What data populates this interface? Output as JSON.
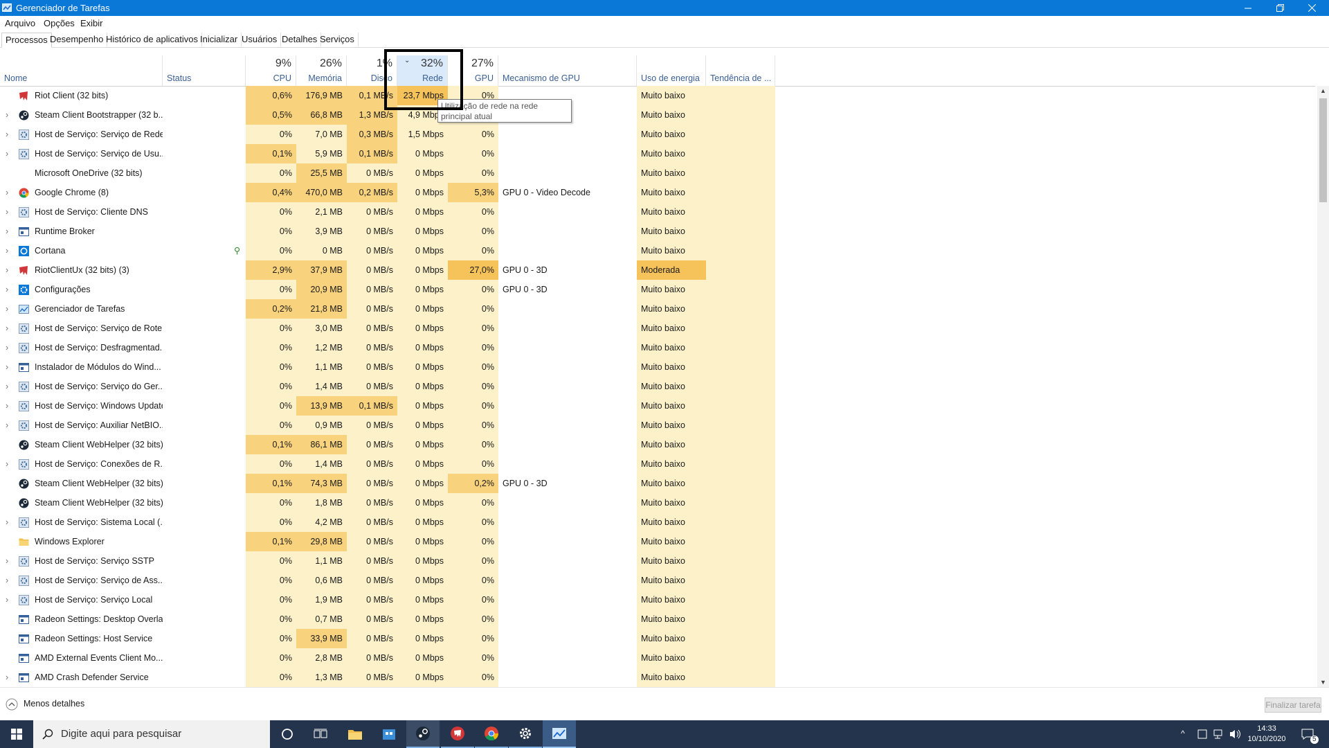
{
  "window": {
    "title": "Gerenciador de Tarefas"
  },
  "menu": [
    "Arquivo",
    "Opções",
    "Exibir"
  ],
  "tabs": [
    "Processos",
    "Desempenho",
    "Histórico de aplicativos",
    "Inicializar",
    "Usuários",
    "Detalhes",
    "Serviços"
  ],
  "columns": {
    "name": "Nome",
    "status": "Status",
    "cpu": {
      "label": "CPU",
      "pct": "9%"
    },
    "memory": {
      "label": "Memória",
      "pct": "26%"
    },
    "disk": {
      "label": "Disco",
      "pct": "1%"
    },
    "network": {
      "label": "Rede",
      "pct": "32%"
    },
    "gpu": {
      "label": "GPU",
      "pct": "27%"
    },
    "gpu_engine": "Mecanismo de GPU",
    "power": "Uso de energia",
    "power_trend": "Tendência de ..."
  },
  "tooltip": "Utilização de rede na rede principal atual",
  "rows": [
    {
      "name": "Riot Client (32 bits)",
      "exp": false,
      "icon": "riot",
      "cpu": "0,6%",
      "mem": "176,9 MB",
      "disk": "0,1 MB/s",
      "net": "23,7 Mbps",
      "gpu": "0%",
      "engine": "",
      "power": "Muito baixo"
    },
    {
      "name": "Steam Client Bootstrapper (32 b...",
      "exp": true,
      "icon": "steam",
      "cpu": "0,5%",
      "mem": "66,8 MB",
      "disk": "1,3 MB/s",
      "net": "4,9 Mbps",
      "gpu": "0%",
      "engine": "",
      "power": "Muito baixo"
    },
    {
      "name": "Host de Serviço: Serviço de Rede",
      "exp": true,
      "icon": "gear",
      "cpu": "0%",
      "mem": "7,0 MB",
      "disk": "0,3 MB/s",
      "net": "1,5 Mbps",
      "gpu": "0%",
      "engine": "",
      "power": "Muito baixo"
    },
    {
      "name": "Host de Serviço: Serviço de Usu...",
      "exp": true,
      "icon": "gear",
      "cpu": "0,1%",
      "mem": "5,9 MB",
      "disk": "0,1 MB/s",
      "net": "0 Mbps",
      "gpu": "0%",
      "engine": "",
      "power": "Muito baixo"
    },
    {
      "name": "Microsoft OneDrive (32 bits)",
      "exp": false,
      "icon": "none",
      "cpu": "0%",
      "mem": "25,5 MB",
      "disk": "0 MB/s",
      "net": "0 Mbps",
      "gpu": "0%",
      "engine": "",
      "power": "Muito baixo"
    },
    {
      "name": "Google Chrome (8)",
      "exp": true,
      "icon": "chrome",
      "cpu": "0,4%",
      "mem": "470,0 MB",
      "disk": "0,2 MB/s",
      "net": "0 Mbps",
      "gpu": "5,3%",
      "engine": "GPU 0 - Video Decode",
      "power": "Muito baixo"
    },
    {
      "name": "Host de Serviço: Cliente DNS",
      "exp": true,
      "icon": "gear",
      "cpu": "0%",
      "mem": "2,1 MB",
      "disk": "0 MB/s",
      "net": "0 Mbps",
      "gpu": "0%",
      "engine": "",
      "power": "Muito baixo"
    },
    {
      "name": "Runtime Broker",
      "exp": true,
      "icon": "window",
      "cpu": "0%",
      "mem": "3,9 MB",
      "disk": "0 MB/s",
      "net": "0 Mbps",
      "gpu": "0%",
      "engine": "",
      "power": "Muito baixo"
    },
    {
      "name": "Cortana",
      "exp": true,
      "icon": "cortana",
      "status_icon": true,
      "cpu": "0%",
      "mem": "0 MB",
      "disk": "0 MB/s",
      "net": "0 Mbps",
      "gpu": "0%",
      "engine": "",
      "power": "Muito baixo"
    },
    {
      "name": "RiotClientUx (32 bits) (3)",
      "exp": true,
      "icon": "riot",
      "cpu": "2,9%",
      "mem": "37,9 MB",
      "disk": "0 MB/s",
      "net": "0 Mbps",
      "gpu": "27,0%",
      "engine": "GPU 0 - 3D",
      "power": "Moderada"
    },
    {
      "name": "Configurações",
      "exp": true,
      "icon": "settings",
      "cpu": "0%",
      "mem": "20,9 MB",
      "disk": "0 MB/s",
      "net": "0 Mbps",
      "gpu": "0%",
      "engine": "GPU 0 - 3D",
      "power": "Muito baixo"
    },
    {
      "name": "Gerenciador de Tarefas",
      "exp": true,
      "icon": "taskmgr",
      "cpu": "0,2%",
      "mem": "21,8 MB",
      "disk": "0 MB/s",
      "net": "0 Mbps",
      "gpu": "0%",
      "engine": "",
      "power": "Muito baixo"
    },
    {
      "name": "Host de Serviço: Serviço de Rote...",
      "exp": true,
      "icon": "gear",
      "cpu": "0%",
      "mem": "3,0 MB",
      "disk": "0 MB/s",
      "net": "0 Mbps",
      "gpu": "0%",
      "engine": "",
      "power": "Muito baixo"
    },
    {
      "name": "Host de Serviço: Desfragmentad...",
      "exp": true,
      "icon": "gear",
      "cpu": "0%",
      "mem": "1,2 MB",
      "disk": "0 MB/s",
      "net": "0 Mbps",
      "gpu": "0%",
      "engine": "",
      "power": "Muito baixo"
    },
    {
      "name": "Instalador de Módulos do Wind...",
      "exp": true,
      "icon": "window",
      "cpu": "0%",
      "mem": "1,1 MB",
      "disk": "0 MB/s",
      "net": "0 Mbps",
      "gpu": "0%",
      "engine": "",
      "power": "Muito baixo"
    },
    {
      "name": "Host de Serviço: Serviço do Ger...",
      "exp": true,
      "icon": "gear",
      "cpu": "0%",
      "mem": "1,4 MB",
      "disk": "0 MB/s",
      "net": "0 Mbps",
      "gpu": "0%",
      "engine": "",
      "power": "Muito baixo"
    },
    {
      "name": "Host de Serviço: Windows Update",
      "exp": true,
      "icon": "gear",
      "cpu": "0%",
      "mem": "13,9 MB",
      "disk": "0,1 MB/s",
      "net": "0 Mbps",
      "gpu": "0%",
      "engine": "",
      "power": "Muito baixo"
    },
    {
      "name": "Host de Serviço: Auxiliar NetBIO...",
      "exp": true,
      "icon": "gear",
      "cpu": "0%",
      "mem": "0,9 MB",
      "disk": "0 MB/s",
      "net": "0 Mbps",
      "gpu": "0%",
      "engine": "",
      "power": "Muito baixo"
    },
    {
      "name": "Steam Client WebHelper (32 bits)",
      "exp": false,
      "icon": "steam",
      "cpu": "0,1%",
      "mem": "86,1 MB",
      "disk": "0 MB/s",
      "net": "0 Mbps",
      "gpu": "0%",
      "engine": "",
      "power": "Muito baixo"
    },
    {
      "name": "Host de Serviço: Conexões de R...",
      "exp": true,
      "icon": "gear",
      "cpu": "0%",
      "mem": "1,4 MB",
      "disk": "0 MB/s",
      "net": "0 Mbps",
      "gpu": "0%",
      "engine": "",
      "power": "Muito baixo"
    },
    {
      "name": "Steam Client WebHelper (32 bits)",
      "exp": false,
      "icon": "steam",
      "cpu": "0,1%",
      "mem": "74,3 MB",
      "disk": "0 MB/s",
      "net": "0 Mbps",
      "gpu": "0,2%",
      "engine": "GPU 0 - 3D",
      "power": "Muito baixo"
    },
    {
      "name": "Steam Client WebHelper (32 bits)",
      "exp": false,
      "icon": "steam",
      "cpu": "0%",
      "mem": "1,8 MB",
      "disk": "0 MB/s",
      "net": "0 Mbps",
      "gpu": "0%",
      "engine": "",
      "power": "Muito baixo"
    },
    {
      "name": "Host de Serviço: Sistema Local (...",
      "exp": true,
      "icon": "gear",
      "cpu": "0%",
      "mem": "4,2 MB",
      "disk": "0 MB/s",
      "net": "0 Mbps",
      "gpu": "0%",
      "engine": "",
      "power": "Muito baixo"
    },
    {
      "name": "Windows Explorer",
      "exp": false,
      "icon": "folder",
      "cpu": "0,1%",
      "mem": "29,8 MB",
      "disk": "0 MB/s",
      "net": "0 Mbps",
      "gpu": "0%",
      "engine": "",
      "power": "Muito baixo"
    },
    {
      "name": "Host de Serviço: Serviço SSTP",
      "exp": true,
      "icon": "gear",
      "cpu": "0%",
      "mem": "1,1 MB",
      "disk": "0 MB/s",
      "net": "0 Mbps",
      "gpu": "0%",
      "engine": "",
      "power": "Muito baixo"
    },
    {
      "name": "Host de Serviço: Serviço de Ass...",
      "exp": true,
      "icon": "gear",
      "cpu": "0%",
      "mem": "0,6 MB",
      "disk": "0 MB/s",
      "net": "0 Mbps",
      "gpu": "0%",
      "engine": "",
      "power": "Muito baixo"
    },
    {
      "name": "Host de Serviço: Serviço Local",
      "exp": true,
      "icon": "gear",
      "cpu": "0%",
      "mem": "1,9 MB",
      "disk": "0 MB/s",
      "net": "0 Mbps",
      "gpu": "0%",
      "engine": "",
      "power": "Muito baixo"
    },
    {
      "name": "Radeon Settings: Desktop Overlay",
      "exp": false,
      "icon": "window",
      "cpu": "0%",
      "mem": "0,7 MB",
      "disk": "0 MB/s",
      "net": "0 Mbps",
      "gpu": "0%",
      "engine": "",
      "power": "Muito baixo"
    },
    {
      "name": "Radeon Settings: Host Service",
      "exp": false,
      "icon": "window",
      "cpu": "0%",
      "mem": "33,9 MB",
      "disk": "0 MB/s",
      "net": "0 Mbps",
      "gpu": "0%",
      "engine": "",
      "power": "Muito baixo"
    },
    {
      "name": "AMD External Events Client Mo...",
      "exp": false,
      "icon": "window",
      "cpu": "0%",
      "mem": "2,8 MB",
      "disk": "0 MB/s",
      "net": "0 Mbps",
      "gpu": "0%",
      "engine": "",
      "power": "Muito baixo"
    },
    {
      "name": "AMD Crash Defender Service",
      "exp": true,
      "icon": "window",
      "cpu": "0%",
      "mem": "1,3 MB",
      "disk": "0 MB/s",
      "net": "0 Mbps",
      "gpu": "0%",
      "engine": "",
      "power": "Muito baixo"
    }
  ],
  "footer": {
    "less_details": "Menos detalhes",
    "end_task": "Finalizar tarefa"
  },
  "taskbar": {
    "search_placeholder": "Digite aqui para pesquisar",
    "time": "14:33",
    "date": "10/10/2020",
    "notifications": "5"
  },
  "colors": {
    "accent": "#0a78d7",
    "heat_light": "#fcf1c9",
    "heat_mid": "#f8d27c",
    "heat_high": "#f6c25a"
  }
}
